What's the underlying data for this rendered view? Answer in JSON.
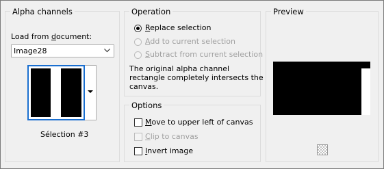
{
  "alpha_channels": {
    "title": "Alpha channels",
    "load_from_label": "Load from document:",
    "document_select": {
      "value": "Image28"
    },
    "selection_caption": "Sélection #3"
  },
  "operation": {
    "title": "Operation",
    "options": [
      {
        "label": "Replace selection",
        "checked": true,
        "enabled": true
      },
      {
        "label": "Add to current selection",
        "checked": false,
        "enabled": false
      },
      {
        "label": "Subtract from current selection",
        "checked": false,
        "enabled": false
      }
    ],
    "message_line1": "The original alpha channel",
    "message_line2": "rectangle completely intersects the",
    "message_line3": "canvas."
  },
  "options": {
    "title": "Options",
    "checkboxes": [
      {
        "label": "Move to upper left of canvas",
        "checked": false,
        "enabled": true
      },
      {
        "label": "Clip to canvas",
        "checked": false,
        "enabled": false
      },
      {
        "label": "Invert image",
        "checked": false,
        "enabled": true
      }
    ]
  },
  "preview": {
    "title": "Preview",
    "zoom_icon": "checkerboard-icon"
  }
}
